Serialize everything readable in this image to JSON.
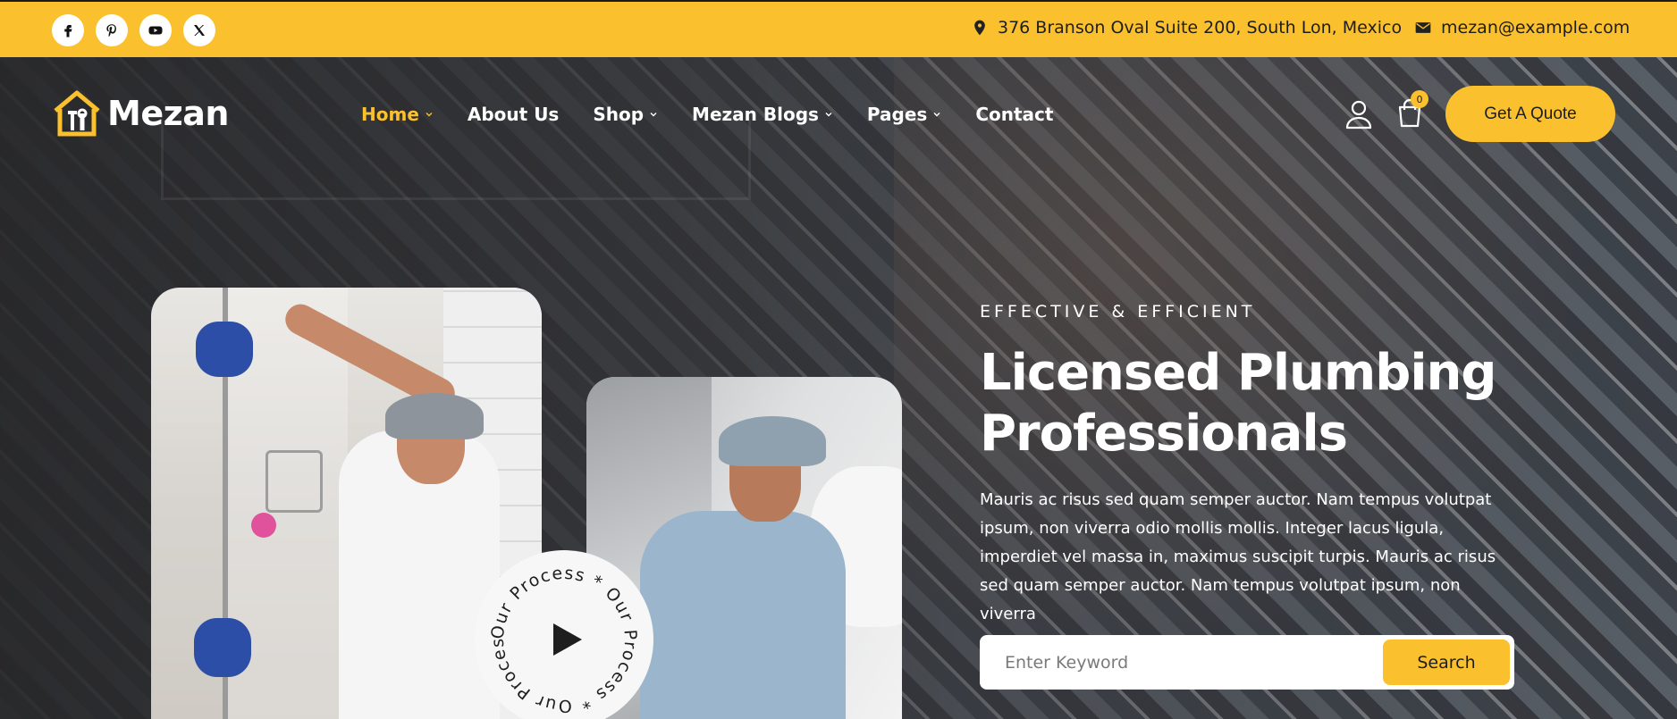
{
  "topbar": {
    "socials": [
      "facebook-icon",
      "pinterest-icon",
      "youtube-icon",
      "x-icon"
    ],
    "address": "376 Branson Oval Suite 200, South Lon, Mexico",
    "email": "mezan@example.com"
  },
  "header": {
    "logo_text": "Mezan",
    "nav": [
      {
        "label": "Home",
        "has_dropdown": true,
        "active": true
      },
      {
        "label": "About Us",
        "has_dropdown": false
      },
      {
        "label": "Shop",
        "has_dropdown": true
      },
      {
        "label": "Mezan Blogs",
        "has_dropdown": true
      },
      {
        "label": "Pages",
        "has_dropdown": true
      },
      {
        "label": "Contact",
        "has_dropdown": false
      }
    ],
    "cart_count": "0",
    "quote_label": "Get A Quote"
  },
  "hero": {
    "eyebrow": "EFFECTIVE & EFFICIENT",
    "headline": "Licensed Plumbing Professionals",
    "body": "Mauris ac risus sed quam semper auctor. Nam tempus volutpat ipsum, non viverra odio mollis mollis. Integer lacus ligula, imperdiet vel massa in, maximus suscipit turpis. Mauris ac risus sed quam semper auctor. Nam tempus volutpat ipsum, non viverra",
    "process_text": "Our Process * Our Process * Our Process * ",
    "search": {
      "placeholder": "Enter Keyword",
      "button": "Search"
    }
  },
  "colors": {
    "accent": "#fbc02d",
    "dark": "#2a2a2c",
    "text_light": "#ffffff"
  }
}
